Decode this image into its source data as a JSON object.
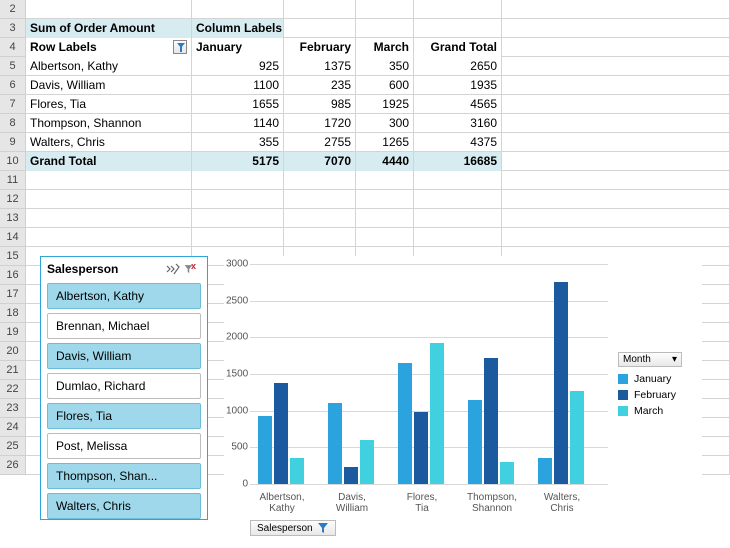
{
  "row_numbers": [
    "2",
    "3",
    "4",
    "5",
    "6",
    "7",
    "8",
    "9",
    "10",
    "11",
    "12",
    "13",
    "14",
    "15",
    "16",
    "17",
    "18",
    "19",
    "20",
    "21",
    "22",
    "23",
    "24",
    "25",
    "26"
  ],
  "pivot": {
    "top_left_label": "Sum of Order Amount",
    "column_labels_label": "Column Labels",
    "row_labels_label": "Row Labels",
    "columns": [
      "January",
      "February",
      "March",
      "Grand Total"
    ],
    "rows": [
      {
        "name": "Albertson, Kathy",
        "vals": [
          "925",
          "1375",
          "350",
          "2650"
        ]
      },
      {
        "name": "Davis, William",
        "vals": [
          "1100",
          "235",
          "600",
          "1935"
        ]
      },
      {
        "name": "Flores, Tia",
        "vals": [
          "1655",
          "985",
          "1925",
          "4565"
        ]
      },
      {
        "name": "Thompson, Shannon",
        "vals": [
          "1140",
          "1720",
          "300",
          "3160"
        ]
      },
      {
        "name": "Walters, Chris",
        "vals": [
          "355",
          "2755",
          "1265",
          "4375"
        ]
      }
    ],
    "grand_total_label": "Grand Total",
    "grand_totals": [
      "5175",
      "7070",
      "4440",
      "16685"
    ]
  },
  "slicer": {
    "title": "Salesperson",
    "items": [
      {
        "label": "Albertson, Kathy",
        "selected": true
      },
      {
        "label": "Brennan, Michael",
        "selected": false
      },
      {
        "label": "Davis, William",
        "selected": true
      },
      {
        "label": "Dumlao, Richard",
        "selected": false
      },
      {
        "label": "Flores, Tia",
        "selected": true
      },
      {
        "label": "Post, Melissa",
        "selected": false
      },
      {
        "label": "Thompson, Shan...",
        "selected": true
      },
      {
        "label": "Walters, Chris",
        "selected": true
      }
    ]
  },
  "chart_data": {
    "type": "bar",
    "legend_title": "Month",
    "series": [
      {
        "name": "January",
        "values": [
          925,
          1100,
          1655,
          1140,
          355
        ],
        "color": "#2aa3de"
      },
      {
        "name": "February",
        "values": [
          1375,
          235,
          985,
          1720,
          2755
        ],
        "color": "#1b5a9e"
      },
      {
        "name": "March",
        "values": [
          350,
          600,
          1925,
          300,
          1265
        ],
        "color": "#41d0e0"
      }
    ],
    "categories": [
      "Albertson, Kathy",
      "Davis, William",
      "Flores, Tia",
      "Thompson, Shannon",
      "Walters, Chris"
    ],
    "ylim": [
      0,
      3000
    ],
    "yticks": [
      0,
      500,
      1000,
      1500,
      2000,
      2500,
      3000
    ],
    "field_button": "Salesperson",
    "xlabel": "",
    "ylabel": "",
    "title": ""
  }
}
